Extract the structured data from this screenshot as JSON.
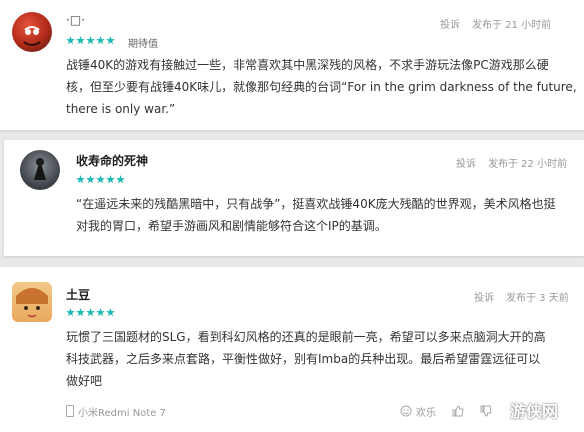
{
  "reviews": [
    {
      "username": "·□·",
      "rating_label": "期待值",
      "stars": 5,
      "report": "投诉",
      "time": "发布于 21 小时前",
      "lines": [
        "战锤40K的游戏有接触过一些，非常喜欢其中黑深残的风格，不求手游玩法像PC游戏那么硬",
        "核，但至少要有战锤40K味儿，就像那句经典的台词“For in the grim darkness of the future,",
        "there is only war.”"
      ]
    },
    {
      "username": "收寿命的死神",
      "stars": 5,
      "report": "投诉",
      "time": "发布于 22 小时前",
      "lines": [
        "“在遥远未来的残酷黑暗中，只有战争”，挺喜欢战锤40K庞大残酷的世界观，美术风格也挺",
        "对我的胃口，希望手游画风和剧情能够符合这个IP的基调。"
      ]
    },
    {
      "username": "土豆",
      "stars": 5,
      "report": "投诉",
      "time": "发布于 3 天前",
      "lines": [
        "玩惯了三国题材的SLG，看到科幻风格的还真的是眼前一亮，希望可以多来点脑洞大开的高",
        "科技武器，之后多来点套路，平衡性做好，别有Imba的兵种出现。最后希望雷霆远征可以",
        "做好吧"
      ],
      "device": "小米Redmi Note 7",
      "like_label": "欢乐"
    }
  ],
  "watermark": "游侠网",
  "colors": {
    "star": "#19b9b3",
    "background": "#e9e9e9"
  }
}
